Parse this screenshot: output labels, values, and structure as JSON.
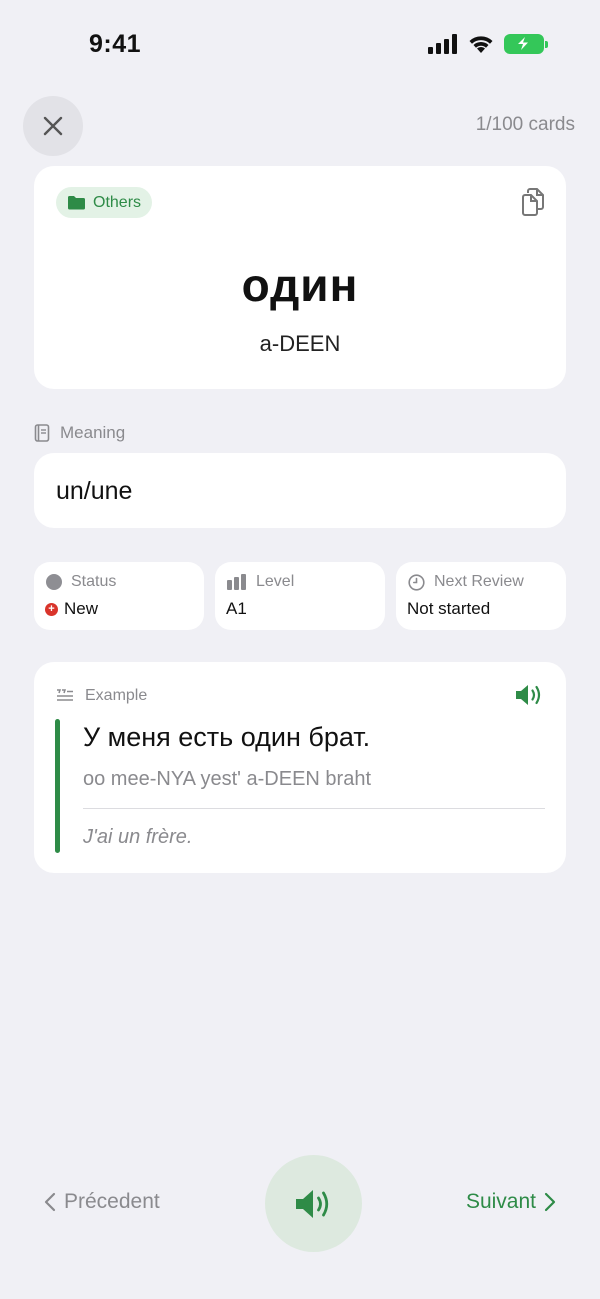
{
  "status_bar": {
    "time": "9:41"
  },
  "header": {
    "counter": "1/100 cards"
  },
  "word_card": {
    "tag": "Others",
    "word": "один",
    "transliteration": "a-DEEN"
  },
  "meaning": {
    "label": "Meaning",
    "text": "un/une"
  },
  "info": {
    "status_label": "Status",
    "status_value": "New",
    "level_label": "Level",
    "level_value": "A1",
    "review_label": "Next Review",
    "review_value": "Not started"
  },
  "example": {
    "label": "Example",
    "sentence": "У меня есть один брат.",
    "transliteration": "oo mee-NYA yest' a-DEEN braht",
    "translation": "J'ai un frère."
  },
  "navigation": {
    "previous": "Précedent",
    "next": "Suivant"
  },
  "icons": {
    "close": "close-icon",
    "folder": "folder-icon",
    "copy": "copy-icon",
    "book": "book-icon",
    "speaker": "speaker-icon",
    "clock": "clock-icon",
    "level_bars": "level-bars-icon",
    "quote": "quote-icon",
    "chevron_left": "chevron-left-icon",
    "chevron_right": "chevron-right-icon"
  },
  "colors": {
    "accent_green": "#2e8b47",
    "new_badge_red": "#d9342b",
    "background": "#f0f0f5",
    "battery_green": "#34c759"
  }
}
